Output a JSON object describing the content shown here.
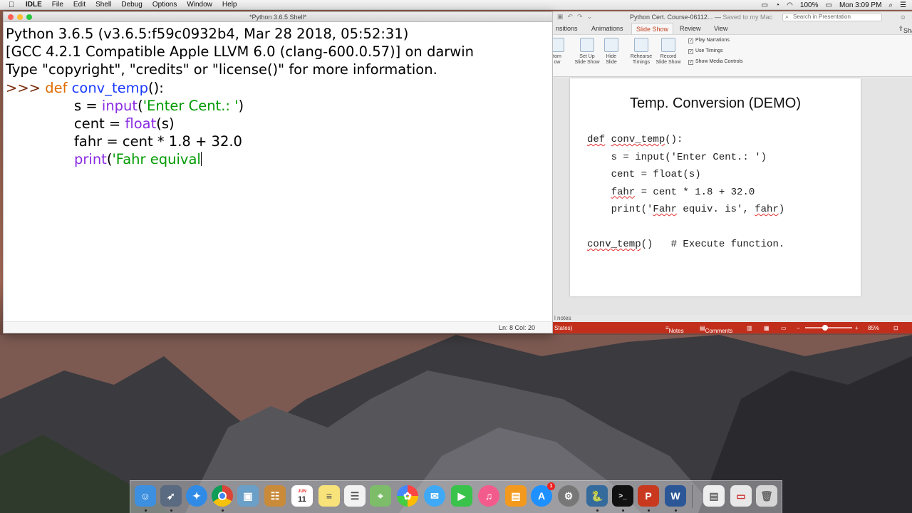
{
  "menubar": {
    "apple": "",
    "items": [
      "IDLE",
      "File",
      "Edit",
      "Shell",
      "Debug",
      "Options",
      "Window",
      "Help"
    ],
    "battery": "100%",
    "clock": "Mon 3:09 PM"
  },
  "idle": {
    "title": "*Python 3.6.5 Shell*",
    "banner": [
      "Python 3.6.5 (v3.6.5:f59c0932b4, Mar 28 2018, 05:52:31)",
      "[GCC 4.2.1 Compatible Apple LLVM 6.0 (clang-600.0.57)] on darwin",
      "Type \"copyright\", \"credits\" or \"license()\" for more information."
    ],
    "code": {
      "prompt": ">>> ",
      "kw_def": "def",
      "fn_name": "conv_temp",
      "def_tail": "():",
      "l2_a": "s = ",
      "l2_fn": "input",
      "l2_paren": "(",
      "l2_str": "'Enter Cent.: '",
      "l2_close": ")",
      "l3_a": "cent = ",
      "l3_fn": "float",
      "l3_b": "(s)",
      "l4": "fahr = cent * 1.8 + 32.0",
      "l5_fn": "print",
      "l5_paren": "(",
      "l5_str": "'Fahr equival"
    },
    "status": "Ln: 8   Col: 20"
  },
  "ppt": {
    "document": "Python Cert. Course-06112...",
    "saved": "Saved to my Mac",
    "search_placeholder": "Search in Presentation",
    "tabs": [
      "nsitions",
      "Animations",
      "Slide Show",
      "Review",
      "View"
    ],
    "active_tab": "Slide Show",
    "share": "Share",
    "ribbon": {
      "custom": [
        "tom",
        "ow"
      ],
      "setup": [
        "Set Up",
        "Slide Show"
      ],
      "hide": [
        "Hide",
        "Slide"
      ],
      "rehearse": [
        "Rehearse",
        "Timings"
      ],
      "record": [
        "Record",
        "Slide Show"
      ],
      "checks": [
        "Play Narrations",
        "Use Timings",
        "Show Media Controls"
      ]
    },
    "slide": {
      "title": "Temp. Conversion (DEMO)",
      "code": [
        {
          "a": "",
          "s": "def",
          "b": " ",
          "s2": "conv_temp",
          "c": "():"
        },
        {
          "a": "    s = input('Enter Cent.: ')",
          "s": "",
          "b": "",
          "s2": "",
          "c": ""
        },
        {
          "a": "    cent = float(s)",
          "s": "",
          "b": "",
          "s2": "",
          "c": ""
        },
        {
          "a": "    ",
          "s": "fahr",
          "b": " = cent * 1.8 + 32.0",
          "s2": "",
          "c": ""
        },
        {
          "a": "    print('",
          "s": "Fahr",
          "b": " equiv. is', ",
          "s2": "fahr",
          "c": ")"
        },
        {
          "a": "",
          "s": "",
          "b": "",
          "s2": "",
          "c": ""
        },
        {
          "a": "",
          "s": "conv_temp",
          "b": "()   # Execute function.",
          "s2": "",
          "c": ""
        }
      ]
    },
    "notes_label": "l notes",
    "status": {
      "left": "States)",
      "notes": "Notes",
      "comments": "Comments",
      "zoom": "85%"
    }
  },
  "dock": {
    "calendar_month": "JUN",
    "calendar_day": "11",
    "appstore_badge": "1"
  }
}
